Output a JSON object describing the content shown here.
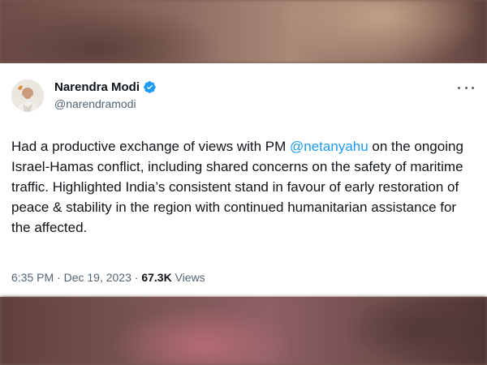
{
  "author": {
    "name": "Narendra Modi",
    "handle": "@narendramodi",
    "verified_icon": "verified-badge-icon",
    "verified_color": "#1d9bf0"
  },
  "tweet": {
    "text_before_mention": "Had a productive exchange of views with PM ",
    "mention": "@netanyahu",
    "text_after_mention": " on the ongoing Israel-Hamas conflict, including shared concerns on the safety of maritime traffic. Highlighted India’s consistent stand in favour of early restoration of peace & stability in the region with continued humanitarian assistance for the affected.",
    "mention_color": "#1d9bf0"
  },
  "meta": {
    "time": "6:35 PM",
    "separator": " · ",
    "date": "Dec 19, 2023",
    "views_count": "67.3K",
    "views_label": " Views"
  },
  "more_menu_icon": "more-horizontal-icon"
}
